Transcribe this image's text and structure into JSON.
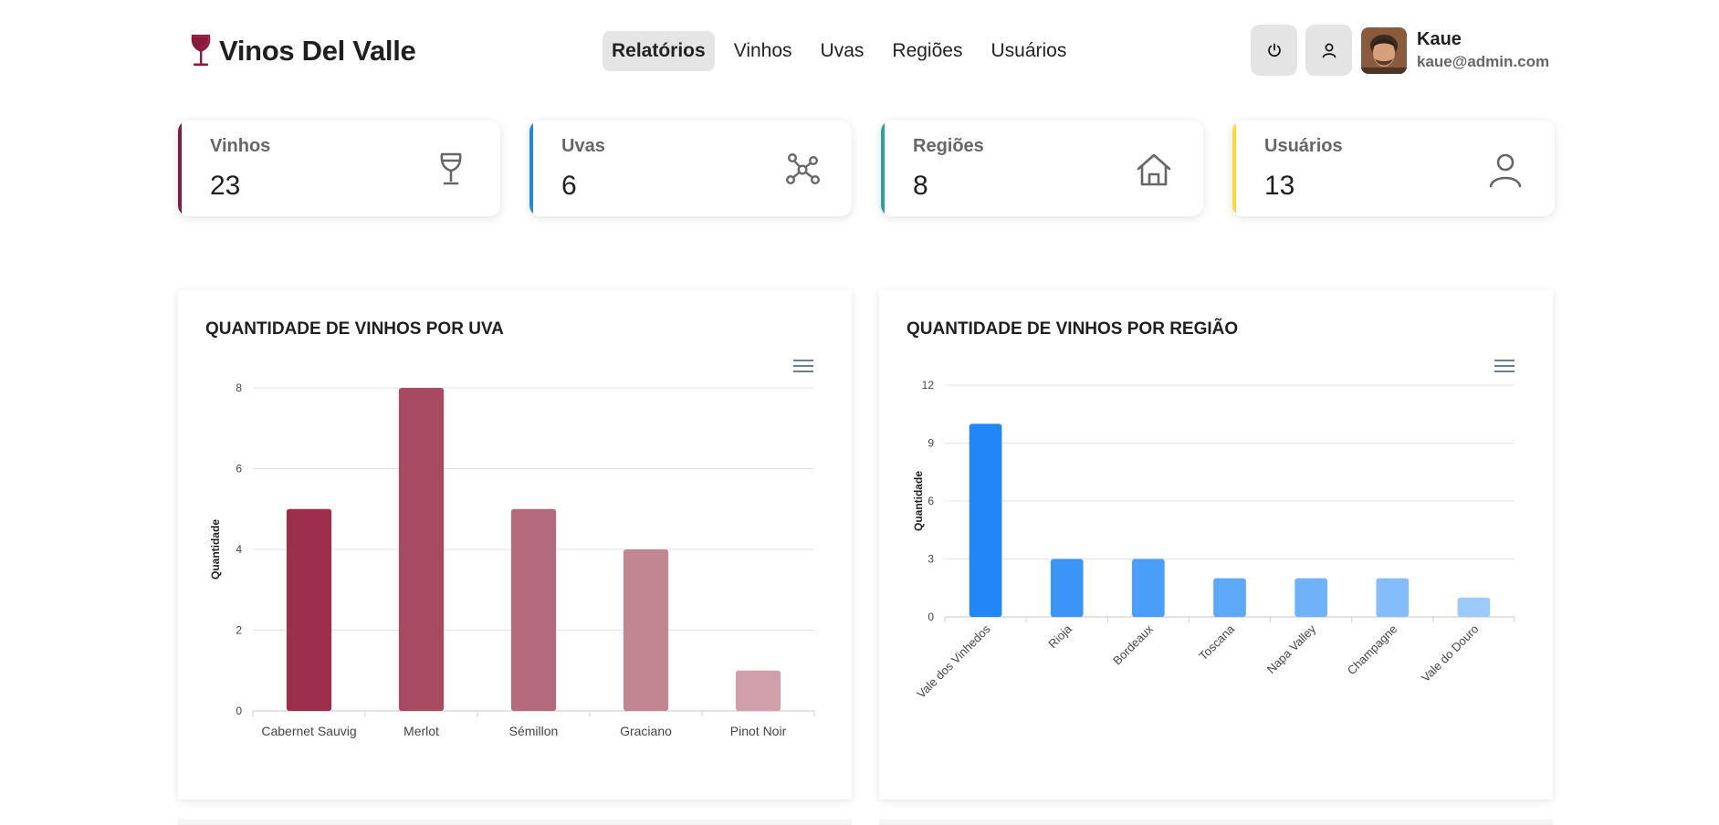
{
  "app": {
    "title": "Vinos Del Valle",
    "logo_icon": "wine-glass-icon",
    "brand_color": "#8b1a3a"
  },
  "nav": {
    "items": [
      {
        "label": "Relatórios",
        "active": true
      },
      {
        "label": "Vinhos",
        "active": false
      },
      {
        "label": "Uvas",
        "active": false
      },
      {
        "label": "Regiões",
        "active": false
      },
      {
        "label": "Usuários",
        "active": false
      }
    ]
  },
  "user": {
    "name": "Kaue",
    "email": "kaue@admin.com",
    "logout_icon": "power-icon",
    "profile_icon": "user-icon"
  },
  "stats": [
    {
      "label": "Vinhos",
      "value": "23",
      "icon": "wine-glass-icon",
      "color": "#8b1a3a"
    },
    {
      "label": "Uvas",
      "value": "6",
      "icon": "graph-nodes-icon",
      "color": "#1e88e5"
    },
    {
      "label": "Regiões",
      "value": "8",
      "icon": "house-icon",
      "color": "#26a69a"
    },
    {
      "label": "Usuários",
      "value": "13",
      "icon": "user-icon",
      "color": "#fdd835"
    }
  ],
  "charts": {
    "uva": {
      "title": "QUANTIDADE DE VINHOS POR UVA",
      "menu_icon": "hamburger-menu-icon"
    },
    "regiao": {
      "title": "QUANTIDADE DE VINHOS POR REGIÃO",
      "menu_icon": "hamburger-menu-icon"
    }
  },
  "chart_data": [
    {
      "type": "bar",
      "title": "QUANTIDADE DE VINHOS POR UVA",
      "categories": [
        "Cabernet Sauvig",
        "Merlot",
        "Sémillon",
        "Graciano",
        "Pinot Noir"
      ],
      "values": [
        5,
        8,
        5,
        4,
        1
      ],
      "ylabel": "Quantidade",
      "xlabel": "",
      "ylim": [
        0,
        8
      ],
      "yticks": [
        0,
        2,
        4,
        6,
        8
      ],
      "colors": [
        "#9c2f4c",
        "#a84b62",
        "#b56a7c",
        "#c28592",
        "#cfa0aa"
      ],
      "grid": true,
      "x_label_rotation": 0
    },
    {
      "type": "bar",
      "title": "QUANTIDADE DE VINHOS POR REGIÃO",
      "categories": [
        "Vale dos Vinhedos",
        "Rioja",
        "Bordeaux",
        "Toscana",
        "Napa Valley",
        "Champagne",
        "Vale do Douro"
      ],
      "values": [
        10,
        3,
        3,
        2,
        2,
        2,
        1
      ],
      "ylabel": "Quantidade",
      "xlabel": "",
      "ylim": [
        0,
        12
      ],
      "yticks": [
        0,
        3,
        6,
        9,
        12
      ],
      "colors": [
        "#2287f6",
        "#3b95f8",
        "#4a9df8",
        "#5ea8f9",
        "#6fb2f9",
        "#83bdfa",
        "#9ccafb"
      ],
      "grid": true,
      "x_label_rotation": -45
    }
  ]
}
